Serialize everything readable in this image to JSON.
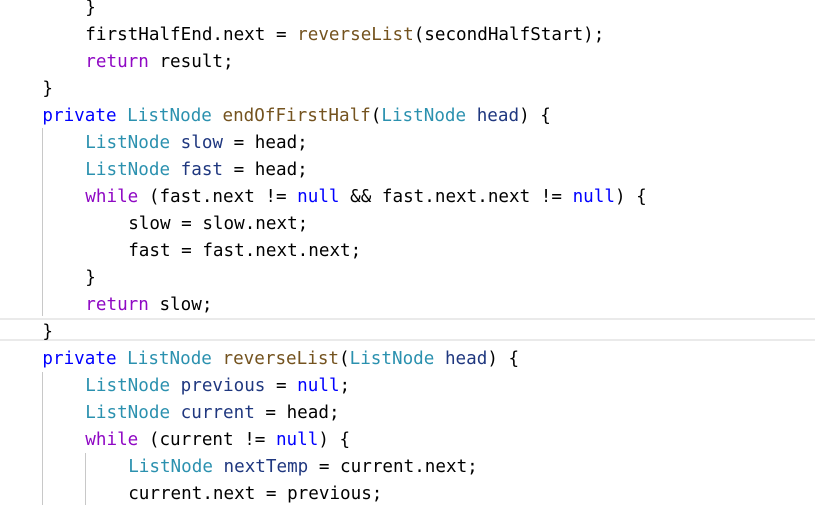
{
  "editor": {
    "colors": {
      "keyword": "#0000ff",
      "control": "#8f08c4",
      "type": "#2b91af",
      "method": "#74531f",
      "variable": "#1f377f"
    },
    "current_line": 12,
    "lines": [
      {
        "indent": 2,
        "tokens": [
          [
            "}",
            "pl"
          ]
        ]
      },
      {
        "indent": 2,
        "tokens": [
          [
            "firstHalfEnd.next = ",
            "pl"
          ],
          [
            "reverseList",
            "fn"
          ],
          [
            "(secondHalfStart);",
            "pl"
          ]
        ]
      },
      {
        "indent": 2,
        "tokens": [
          [
            "return",
            "ctl"
          ],
          [
            " result;",
            "pl"
          ]
        ]
      },
      {
        "indent": 1,
        "tokens": [
          [
            "}",
            "pl"
          ]
        ]
      },
      {
        "indent": 1,
        "tokens": [
          [
            "private",
            "kw"
          ],
          [
            " ",
            "pl"
          ],
          [
            "ListNode",
            "ty"
          ],
          [
            " ",
            "pl"
          ],
          [
            "endOfFirstHalf",
            "fn"
          ],
          [
            "(",
            "pl"
          ],
          [
            "ListNode",
            "ty"
          ],
          [
            " ",
            "pl"
          ],
          [
            "head",
            "var"
          ],
          [
            ") {",
            "pl"
          ]
        ]
      },
      {
        "indent": 2,
        "tokens": [
          [
            "ListNode",
            "ty"
          ],
          [
            " ",
            "pl"
          ],
          [
            "slow",
            "var"
          ],
          [
            " = head;",
            "pl"
          ]
        ]
      },
      {
        "indent": 2,
        "tokens": [
          [
            "ListNode",
            "ty"
          ],
          [
            " ",
            "pl"
          ],
          [
            "fast",
            "var"
          ],
          [
            " = head;",
            "pl"
          ]
        ]
      },
      {
        "indent": 2,
        "tokens": [
          [
            "while",
            "ctl"
          ],
          [
            " (fast.next != ",
            "pl"
          ],
          [
            "null",
            "kw"
          ],
          [
            " && fast.next.next != ",
            "pl"
          ],
          [
            "null",
            "kw"
          ],
          [
            ") {",
            "pl"
          ]
        ]
      },
      {
        "indent": 3,
        "tokens": [
          [
            "slow = slow.next;",
            "pl"
          ]
        ]
      },
      {
        "indent": 3,
        "tokens": [
          [
            "fast = fast.next.next;",
            "pl"
          ]
        ]
      },
      {
        "indent": 2,
        "tokens": [
          [
            "}",
            "pl"
          ]
        ]
      },
      {
        "indent": 2,
        "tokens": [
          [
            "return",
            "ctl"
          ],
          [
            " slow;",
            "pl"
          ]
        ]
      },
      {
        "indent": 1,
        "tokens": [
          [
            "}",
            "pl"
          ]
        ]
      },
      {
        "indent": 1,
        "tokens": [
          [
            "private",
            "kw"
          ],
          [
            " ",
            "pl"
          ],
          [
            "ListNode",
            "ty"
          ],
          [
            " ",
            "pl"
          ],
          [
            "reverseList",
            "fn"
          ],
          [
            "(",
            "pl"
          ],
          [
            "ListNode",
            "ty"
          ],
          [
            " ",
            "pl"
          ],
          [
            "head",
            "var"
          ],
          [
            ") {",
            "pl"
          ]
        ]
      },
      {
        "indent": 2,
        "tokens": [
          [
            "ListNode",
            "ty"
          ],
          [
            " ",
            "pl"
          ],
          [
            "previous",
            "var"
          ],
          [
            " = ",
            "pl"
          ],
          [
            "null",
            "kw"
          ],
          [
            ";",
            "pl"
          ]
        ]
      },
      {
        "indent": 2,
        "tokens": [
          [
            "ListNode",
            "ty"
          ],
          [
            " ",
            "pl"
          ],
          [
            "current",
            "var"
          ],
          [
            " = head;",
            "pl"
          ]
        ]
      },
      {
        "indent": 2,
        "tokens": [
          [
            "while",
            "ctl"
          ],
          [
            " (current != ",
            "pl"
          ],
          [
            "null",
            "kw"
          ],
          [
            ") {",
            "pl"
          ]
        ]
      },
      {
        "indent": 3,
        "tokens": [
          [
            "ListNode",
            "ty"
          ],
          [
            " ",
            "pl"
          ],
          [
            "nextTemp",
            "var"
          ],
          [
            " = current.next;",
            "pl"
          ]
        ]
      },
      {
        "indent": 3,
        "tokens": [
          [
            "current.next = previous;",
            "pl"
          ]
        ]
      }
    ]
  }
}
